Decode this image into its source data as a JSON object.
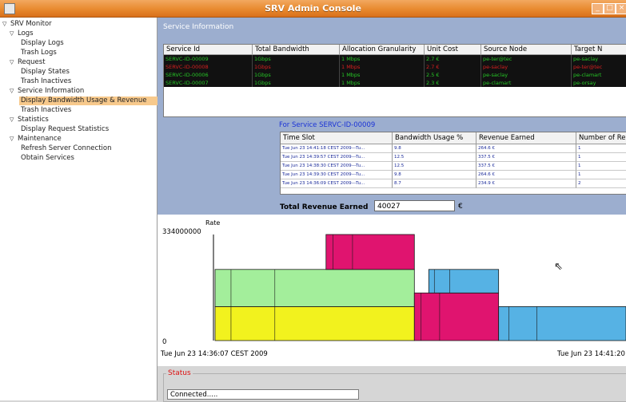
{
  "window": {
    "title": "SRV Admin Console"
  },
  "tree": {
    "root": "SRV Monitor",
    "nodes": [
      {
        "label": "Logs",
        "level": 1,
        "expanded": true
      },
      {
        "label": "Display Logs",
        "level": 2
      },
      {
        "label": "Trash Logs",
        "level": 2
      },
      {
        "label": "Request",
        "level": 1,
        "expanded": true
      },
      {
        "label": "Display States",
        "level": 2
      },
      {
        "label": "Trash Inactives",
        "level": 2
      },
      {
        "label": "Service Information",
        "level": 1,
        "expanded": true
      },
      {
        "label": "Display Bandwidth Usage & Revenue",
        "level": 2,
        "selected": true
      },
      {
        "label": "Trash Inactives",
        "level": 2
      },
      {
        "label": "Statistics",
        "level": 1,
        "expanded": true
      },
      {
        "label": "Display Request Statistics",
        "level": 2
      },
      {
        "label": "Maintenance",
        "level": 1,
        "expanded": true
      },
      {
        "label": "Refresh Server Connection",
        "level": 2
      },
      {
        "label": "Obtain Services",
        "level": 2
      }
    ]
  },
  "service_panel": {
    "label": "Service Information",
    "columns": [
      "Service Id",
      "Total Bandwidth",
      "Allocation Granularity",
      "Unit Cost",
      "Source Node",
      "Target N"
    ],
    "rows": [
      {
        "cells": [
          "SERVC-ID-00009",
          "1Gbps",
          "1 Mbps",
          "2.7 €",
          "pe-ter@tec",
          "pe-saclay"
        ],
        "status": "green"
      },
      {
        "cells": [
          "SERVC-ID-00008",
          "1Gbps",
          "1 Mbps",
          "2.7 €",
          "pe-saclay",
          "pe-ter@tec"
        ],
        "status": "red"
      },
      {
        "cells": [
          "SERVC-ID-00006",
          "1Gbps",
          "1 Mbps",
          "2.5 €",
          "pe-saclay",
          "pe-clamart"
        ],
        "status": "green"
      },
      {
        "cells": [
          "SERVC-ID-00007",
          "1Gbps",
          "1 Mbps",
          "2.3 €",
          "pe-clamart",
          "pe-orsay"
        ],
        "status": "green"
      }
    ]
  },
  "detail": {
    "for_label": "For Service SERVC-ID-00009",
    "columns": [
      "Time Slot",
      "Bandwidth Usage %",
      "Revenue Earned",
      "Number of Rec"
    ],
    "rows": [
      [
        "Tue Jun 23 14:41:18 CEST 2009---Tu...",
        "9.8",
        "264.6 €",
        "1"
      ],
      [
        "Tue Jun 23 14:39:57 CEST 2009---Tu...",
        "12.5",
        "337.5 €",
        "1"
      ],
      [
        "Tue Jun 23 14:38:30 CEST 2009---Tu...",
        "12.5",
        "337.5 €",
        "1"
      ],
      [
        "Tue Jun 23 14:39:30 CEST 2009---Tu...",
        "9.8",
        "264.6 €",
        "1"
      ],
      [
        "Tue Jun 23 14:36:09 CEST 2009---Tu...",
        "8.7",
        "234.9 €",
        "2"
      ]
    ],
    "total_label": "Total Revenue Earned",
    "total_value": "40027",
    "currency": "€"
  },
  "chart_data": {
    "type": "area",
    "ylabel": "Rate",
    "ylim": [
      0,
      334000000
    ],
    "ytick_labels": [
      "334000000",
      "0"
    ],
    "x_start_label": "Tue Jun 23 14:36:07 CEST 2009",
    "x_end_label": "Tue Jun 23 14:41:20",
    "colors": {
      "yellow": "#f2f21e",
      "green": "#a3ee9b",
      "magenta": "#e0146f",
      "blue": "#56b2e4"
    },
    "series": [
      {
        "color": "yellow",
        "segments": [
          {
            "x": [
              0.0,
              0.485
            ],
            "y": [
              0,
              107000000
            ]
          }
        ]
      },
      {
        "color": "green",
        "segments": [
          {
            "x": [
              0.0,
              0.485
            ],
            "y": [
              107000000,
              224000000
            ]
          }
        ]
      },
      {
        "color": "magenta",
        "segments": [
          {
            "x": [
              0.27,
              0.485
            ],
            "y": [
              224000000,
              334000000
            ]
          },
          {
            "x": [
              0.485,
              0.69
            ],
            "y": [
              0,
              150000000
            ]
          }
        ]
      },
      {
        "color": "blue",
        "segments": [
          {
            "x": [
              0.52,
              0.69
            ],
            "y": [
              150000000,
              224000000
            ]
          },
          {
            "x": [
              0.69,
              1.0
            ],
            "y": [
              0,
              107000000
            ]
          }
        ]
      }
    ]
  },
  "status": {
    "label": "Status",
    "text": "Connected....."
  }
}
